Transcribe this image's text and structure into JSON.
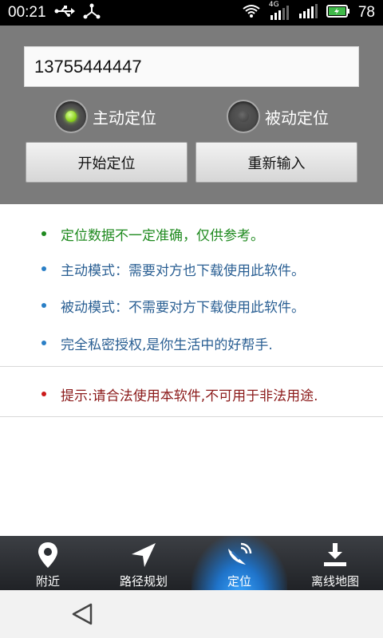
{
  "status_bar": {
    "time": "00:21",
    "network_type": "4G",
    "battery_percent": "78",
    "icons": [
      "usb-icon",
      "share-icon",
      "wifi-icon",
      "signal-icon",
      "signal-icon-2",
      "battery-icon"
    ]
  },
  "form": {
    "phone_value": "13755444447",
    "radio_active": "主动定位",
    "radio_passive": "被动定位",
    "selected": "主动定位",
    "start_button": "开始定位",
    "reset_button": "重新输入"
  },
  "info": {
    "items": [
      {
        "text": "定位数据不一定准确，仅供参考。",
        "color": "#1f8a1f"
      },
      {
        "text": "主动模式：需要对方也下载使用此软件。",
        "color": "#2a5f93"
      },
      {
        "text": "被动模式：不需要对方下载使用此软件。",
        "color": "#2a5f93"
      },
      {
        "text": "完全私密授权,是你生活中的好帮手.",
        "color": "#2a5f93"
      }
    ],
    "warning": {
      "text": "提示:请合法使用本软件,不可用于非法用途.",
      "color": "#8b1a1a"
    }
  },
  "bottom_nav": {
    "items": [
      {
        "label": "附近",
        "icon": "location-pin-icon"
      },
      {
        "label": "路径规划",
        "icon": "navigation-arrow-icon"
      },
      {
        "label": "定位",
        "icon": "satellite-dish-icon",
        "active": true
      },
      {
        "label": "离线地图",
        "icon": "download-icon"
      }
    ]
  },
  "colors": {
    "panel_bg": "#7b7b7b",
    "accent_active": "#2a8ae0"
  }
}
